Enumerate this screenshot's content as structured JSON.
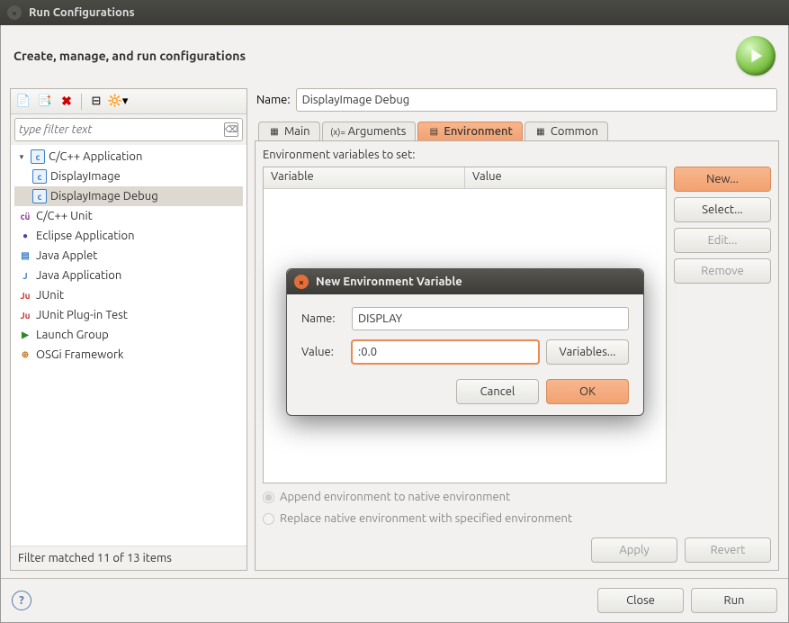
{
  "window_title": "Run Configurations",
  "header_title": "Create, manage, and run configurations",
  "left": {
    "filter_placeholder": "type filter text",
    "tree": [
      {
        "label": "C/C++ Application",
        "kind": "parent",
        "iconClass": "ic-c",
        "iconText": "c"
      },
      {
        "label": "DisplayImage",
        "kind": "child",
        "iconClass": "ic-c",
        "iconText": "c"
      },
      {
        "label": "DisplayImage Debug",
        "kind": "child",
        "iconClass": "ic-c",
        "iconText": "c",
        "selected": true
      },
      {
        "label": "C/C++ Unit",
        "kind": "normal",
        "iconClass": "ic-cu",
        "iconText": "cü"
      },
      {
        "label": "Eclipse Application",
        "kind": "normal",
        "iconClass": "ic-ecl",
        "iconText": "●"
      },
      {
        "label": "Java Applet",
        "kind": "normal",
        "iconClass": "ic-japp",
        "iconText": "▤"
      },
      {
        "label": "Java Application",
        "kind": "normal",
        "iconClass": "ic-japp",
        "iconText": "J"
      },
      {
        "label": "JUnit",
        "kind": "normal",
        "iconClass": "ic-ju",
        "iconText": "Ju"
      },
      {
        "label": "JUnit Plug-in Test",
        "kind": "normal",
        "iconClass": "ic-ju",
        "iconText": "Ju"
      },
      {
        "label": "Launch Group",
        "kind": "normal",
        "iconClass": "ic-lg",
        "iconText": "▶"
      },
      {
        "label": "OSGi Framework",
        "kind": "normal",
        "iconClass": "ic-osgi",
        "iconText": "⊕"
      }
    ],
    "filter_match": "Filter matched 11 of 13 items"
  },
  "right": {
    "name_label": "Name:",
    "name_value": "DisplayImage Debug",
    "tabs": [
      {
        "label": "Main",
        "icon": "▦"
      },
      {
        "label": "Arguments",
        "icon": "(x)="
      },
      {
        "label": "Environment",
        "icon": "▤",
        "active": true
      },
      {
        "label": "Common",
        "icon": "▦"
      }
    ],
    "env_section_label": "Environment variables to set:",
    "table_headers": {
      "col1": "Variable",
      "col2": "Value"
    },
    "buttons": {
      "new": "New...",
      "select": "Select...",
      "edit": "Edit...",
      "remove": "Remove"
    },
    "radio1": "Append environment to native environment",
    "radio2": "Replace native environment with specified environment",
    "apply": "Apply",
    "revert": "Revert"
  },
  "bottom": {
    "close": "Close",
    "run": "Run"
  },
  "modal": {
    "title": "New Environment Variable",
    "name_label": "Name:",
    "name_value": "DISPLAY",
    "value_label": "Value:",
    "value_value": ":0.0",
    "variables_btn": "Variables...",
    "cancel": "Cancel",
    "ok": "OK"
  }
}
